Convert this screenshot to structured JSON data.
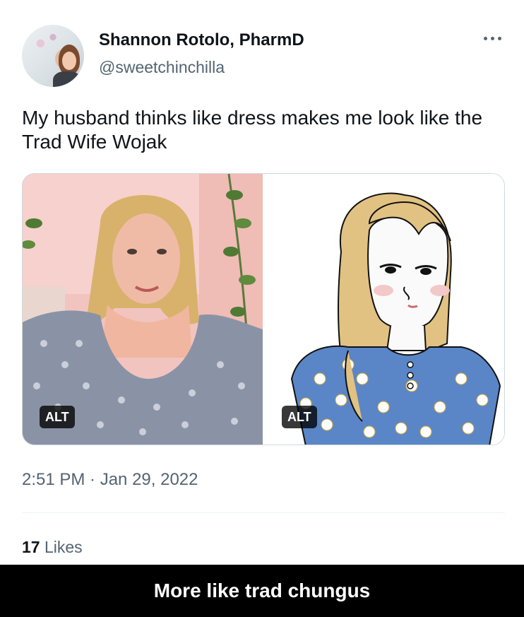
{
  "tweet": {
    "author_name": "Shannon Rotolo, PharmD",
    "author_handle": "@sweetchinchilla",
    "text": "My husband thinks like dress makes me look like the Trad Wife Wojak",
    "media": [
      {
        "alt_badge": "ALT"
      },
      {
        "alt_badge": "ALT"
      }
    ],
    "timestamp": "2:51 PM · Jan 29, 2022",
    "likes_count": "17",
    "likes_label": "Likes"
  },
  "caption": "More like trad chungus",
  "colors": {
    "text_primary": "#0f1419",
    "text_secondary": "#536471",
    "border": "#cfd9de",
    "caption_bg": "#000000"
  }
}
